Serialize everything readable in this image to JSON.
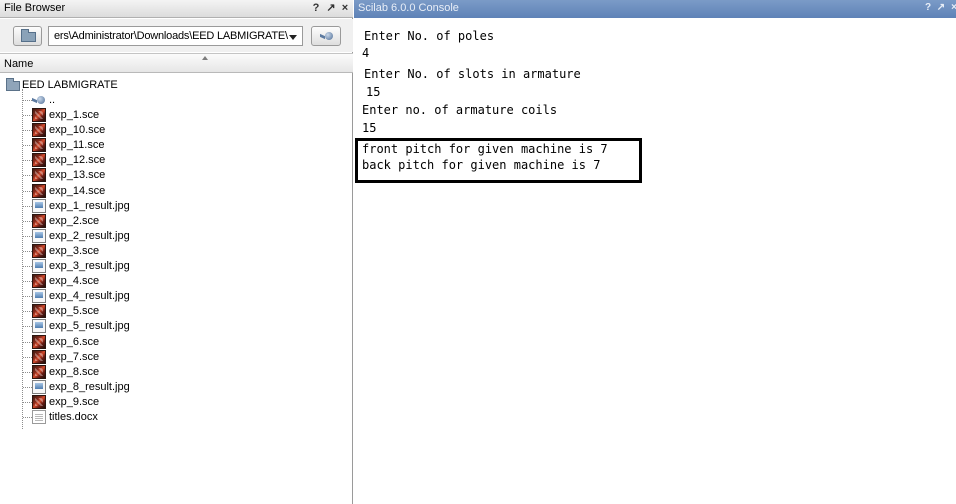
{
  "file_browser": {
    "title": "File Browser",
    "buttons": {
      "help": "?",
      "undock": "↗",
      "close": "×"
    },
    "path": "ers\\Administrator\\Downloads\\EED LABMIGRATE\\",
    "column_header": "Name",
    "root": "EED LABMIGRATE",
    "parent_entry": "..",
    "files": [
      {
        "name": "exp_1.sce",
        "type": "sce"
      },
      {
        "name": "exp_10.sce",
        "type": "sce"
      },
      {
        "name": "exp_11.sce",
        "type": "sce"
      },
      {
        "name": "exp_12.sce",
        "type": "sce"
      },
      {
        "name": "exp_13.sce",
        "type": "sce"
      },
      {
        "name": "exp_14.sce",
        "type": "sce"
      },
      {
        "name": "exp_1_result.jpg",
        "type": "jpg"
      },
      {
        "name": "exp_2.sce",
        "type": "sce"
      },
      {
        "name": "exp_2_result.jpg",
        "type": "jpg"
      },
      {
        "name": "exp_3.sce",
        "type": "sce"
      },
      {
        "name": "exp_3_result.jpg",
        "type": "jpg"
      },
      {
        "name": "exp_4.sce",
        "type": "sce"
      },
      {
        "name": "exp_4_result.jpg",
        "type": "jpg"
      },
      {
        "name": "exp_5.sce",
        "type": "sce"
      },
      {
        "name": "exp_5_result.jpg",
        "type": "jpg"
      },
      {
        "name": "exp_6.sce",
        "type": "sce"
      },
      {
        "name": "exp_7.sce",
        "type": "sce"
      },
      {
        "name": "exp_8.sce",
        "type": "sce"
      },
      {
        "name": "exp_8_result.jpg",
        "type": "jpg"
      },
      {
        "name": "exp_9.sce",
        "type": "sce"
      },
      {
        "name": "titles.docx",
        "type": "docx"
      }
    ]
  },
  "console": {
    "title": "Scilab 6.0.0 Console",
    "buttons": {
      "help": "?",
      "undock": "↗",
      "close": "×"
    },
    "lines": [
      "Enter No. of poles",
      "4",
      "Enter No. of slots in armature",
      "15",
      "Enter no. of armature coils",
      "15",
      "front pitch for given machine is 7",
      "back pitch for given machine is 7"
    ]
  },
  "colors": {
    "console_titlebar": "#6a8cbd",
    "result_box_border": "#000000"
  },
  "icons": {
    "folder": "folder-icon",
    "go": "go-up-icon",
    "sce_file": "scilab-file-icon",
    "jpg_file": "image-file-icon",
    "docx_file": "document-file-icon"
  }
}
